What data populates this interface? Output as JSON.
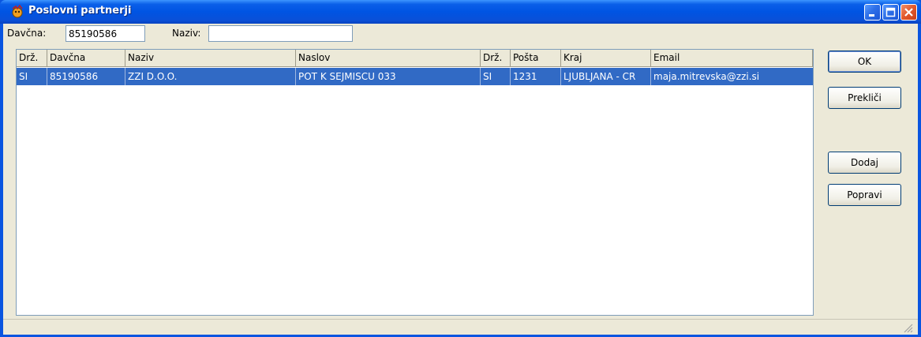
{
  "window": {
    "title": "Poslovni partnerji",
    "icon": "app-icon",
    "controls": [
      "minimize-icon",
      "maximize-icon",
      "close-icon"
    ]
  },
  "search": {
    "davcna_label": "Davčna:",
    "davcna_value": "85190586",
    "naziv_label": "Naziv:",
    "naziv_value": ""
  },
  "grid": {
    "columns": [
      "Drž.",
      "Davčna",
      "Naziv",
      "Naslov",
      "Drž.",
      "Pošta",
      "Kraj",
      "Email"
    ],
    "rows": [
      [
        "SI",
        "85190586",
        "ZZI D.O.O.",
        "POT K SEJMISCU 033",
        "SI",
        "1231",
        "LJUBLJANA - CR",
        "maja.mitrevska@zzi.si"
      ]
    ],
    "selected_row": 0
  },
  "buttons": {
    "ok": "OK",
    "cancel": "Prekliči",
    "add": "Dodaj",
    "edit": "Popravi"
  },
  "colors": {
    "title_bar": "#0054e3",
    "selection": "#316ac5",
    "face": "#ece9d8"
  }
}
